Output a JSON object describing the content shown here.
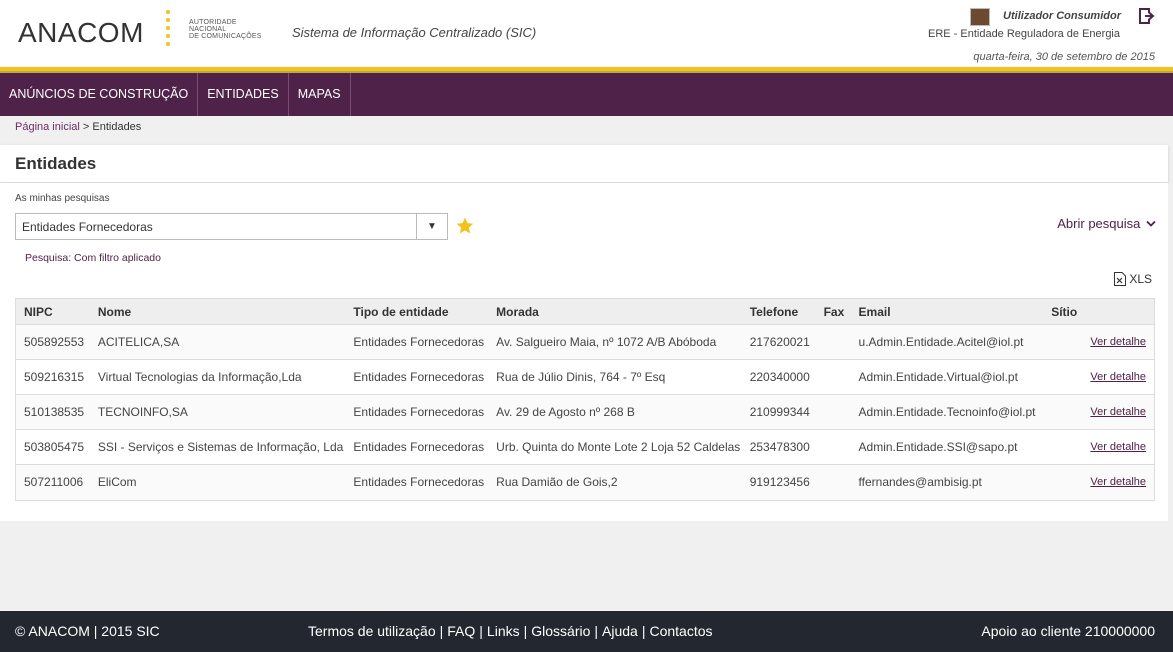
{
  "header": {
    "logo_text": "ANACOM",
    "logo_sub_lines": [
      "AUTORIDADE",
      "NACIONAL",
      "DE COMUNICAÇÕES"
    ],
    "system_title": "Sistema de Informação Centralizado (SIC)",
    "user_name": "Utilizador Consumidor",
    "user_org": "ERE - Entidade Reguladora de Energia",
    "date": "quarta-feira, 30 de setembro de 2015"
  },
  "nav": {
    "items": [
      {
        "label": "ANÚNCIOS DE CONSTRUÇÃO"
      },
      {
        "label": "ENTIDADES"
      },
      {
        "label": "MAPAS"
      }
    ]
  },
  "breadcrumb": {
    "home": "Página inicial",
    "separator": " > ",
    "current": "Entidades"
  },
  "page": {
    "title": "Entidades",
    "my_searches_label": "As minhas pesquisas",
    "selected_search": "Entidades Fornecedoras",
    "open_search": "Abrir pesquisa",
    "filter_status": "Pesquisa: Com filtro aplicado",
    "xls_label": "XLS"
  },
  "table": {
    "columns": [
      "NIPC",
      "Nome",
      "Tipo de entidade",
      "Morada",
      "Telefone",
      "Fax",
      "Email",
      "Sítio"
    ],
    "detail_label": "Ver detalhe",
    "rows": [
      {
        "nipc": "505892553",
        "nome": "ACITELICA,SA",
        "tipo": "Entidades Fornecedoras",
        "morada": "Av. Salgueiro Maia, nº 1072 A/B Abóboda",
        "telefone": "217620021",
        "fax": "",
        "email": "u.Admin.Entidade.Acitel@iol.pt"
      },
      {
        "nipc": "509216315",
        "nome": "Virtual Tecnologias da Informação,Lda",
        "tipo": "Entidades Fornecedoras",
        "morada": "Rua de Júlio Dinis, 764 - 7º Esq",
        "telefone": "220340000",
        "fax": "",
        "email": "Admin.Entidade.Virtual@iol.pt"
      },
      {
        "nipc": "510138535",
        "nome": "TECNOINFO,SA",
        "tipo": "Entidades Fornecedoras",
        "morada": "Av. 29 de Agosto nº 268 B",
        "telefone": "210999344",
        "fax": "",
        "email": "Admin.Entidade.Tecnoinfo@iol.pt"
      },
      {
        "nipc": "503805475",
        "nome": "SSI - Serviços e Sistemas de Informação, Lda",
        "tipo": "Entidades Fornecedoras",
        "morada": "Urb. Quinta do Monte Lote 2 Loja 52 Caldelas",
        "telefone": "253478300",
        "fax": "",
        "email": "Admin.Entidade.SSI@sapo.pt"
      },
      {
        "nipc": "507211006",
        "nome": "EliCom",
        "tipo": "Entidades Fornecedoras",
        "morada": "Rua Damião de Gois,2",
        "telefone": "919123456",
        "fax": "",
        "email": "ffernandes@ambisig.pt"
      }
    ]
  },
  "footer": {
    "copyright": "© ANACOM | 2015 SIC",
    "links": [
      "Termos de utilização",
      "FAQ",
      "Links",
      "Glossário",
      "Ajuda",
      "Contactos"
    ],
    "support": "Apoio ao cliente 210000000"
  },
  "colors": {
    "nav_bg": "#4e2249",
    "accent_yellow": "#f2c21a",
    "footer_bg": "#232830",
    "link": "#4e2249"
  },
  "icons": {
    "logout": "logout-icon",
    "star": "star-icon",
    "xls": "xls-file-icon",
    "dropdown": "chevron-down-icon"
  }
}
